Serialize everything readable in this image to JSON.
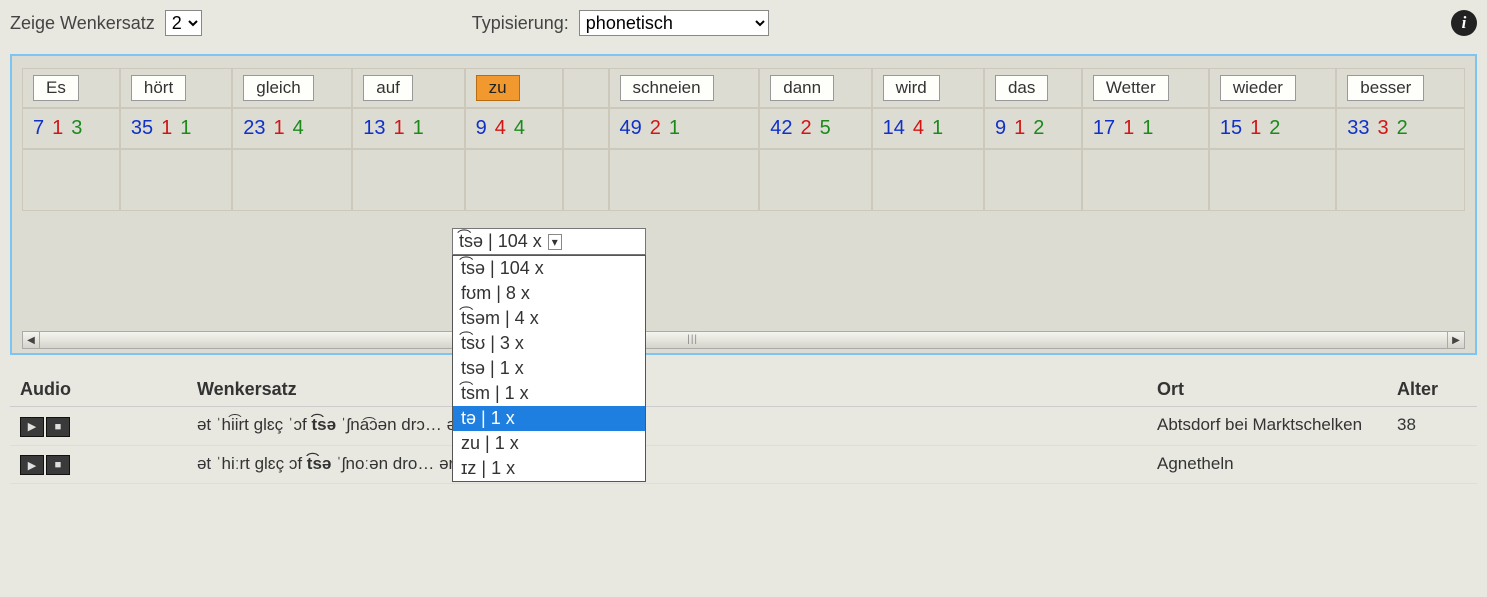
{
  "controls": {
    "show_label": "Zeige Wenkersatz",
    "show_value": "2",
    "typing_label": "Typisierung:",
    "typing_value": "phonetisch"
  },
  "words": [
    {
      "label": "Es",
      "selected": false,
      "counts": [
        "7",
        "1",
        "3"
      ]
    },
    {
      "label": "hört",
      "selected": false,
      "counts": [
        "35",
        "1",
        "1"
      ]
    },
    {
      "label": "gleich",
      "selected": false,
      "counts": [
        "23",
        "1",
        "4"
      ]
    },
    {
      "label": "auf",
      "selected": false,
      "counts": [
        "13",
        "1",
        "1"
      ]
    },
    {
      "label": "zu",
      "selected": true,
      "counts": [
        "9",
        "4",
        "4"
      ]
    },
    {
      "label": "schneien",
      "selected": false,
      "counts": [
        "49",
        "2",
        "1"
      ]
    },
    {
      "label": "dann",
      "selected": false,
      "counts": [
        "42",
        "2",
        "5"
      ]
    },
    {
      "label": "wird",
      "selected": false,
      "counts": [
        "14",
        "4",
        "1"
      ]
    },
    {
      "label": "das",
      "selected": false,
      "counts": [
        "9",
        "1",
        "2"
      ]
    },
    {
      "label": "Wetter",
      "selected": false,
      "counts": [
        "17",
        "1",
        "1"
      ]
    },
    {
      "label": "wieder",
      "selected": false,
      "counts": [
        "15",
        "1",
        "2"
      ]
    },
    {
      "label": "besser",
      "selected": false,
      "counts": [
        "33",
        "3",
        "2"
      ]
    }
  ],
  "gap_after_index": 4,
  "dropdown": {
    "closed_label": "t͡sə | 104 x",
    "options": [
      "t͡sə | 104 x",
      "fʊm | 8 x",
      "t͡səm | 4 x",
      "t͡sʊ | 3 x",
      "tsə | 1 x",
      "t͡sm | 1 x",
      "tə | 1 x",
      "zu | 1 x",
      "ɪz | 1 x"
    ],
    "selected_index": 6
  },
  "table": {
    "headers": {
      "audio": "Audio",
      "sentence": "Wenkersatz",
      "place": "Ort",
      "age": "Alter"
    },
    "rows": [
      {
        "sentence_prefix": "ət ˈhi͡irt glɛç ˈɔf ",
        "sentence_bold": "t͡sə",
        "sentence_suffix": " ˈʃna͡ɔən drɔ…        ər ˈvɛdər ˈgea͡t",
        "place": "Abtsdorf bei Marktschelken",
        "age": "38"
      },
      {
        "sentence_prefix": "ət ˈhiːrt glɛç ɔf ",
        "sentence_bold": "t͡sə",
        "sentence_suffix": " ˈʃnoːən dro…        ər ˈvɛdər ˈbəi͡sər",
        "place": "Agnetheln",
        "age": ""
      }
    ]
  }
}
